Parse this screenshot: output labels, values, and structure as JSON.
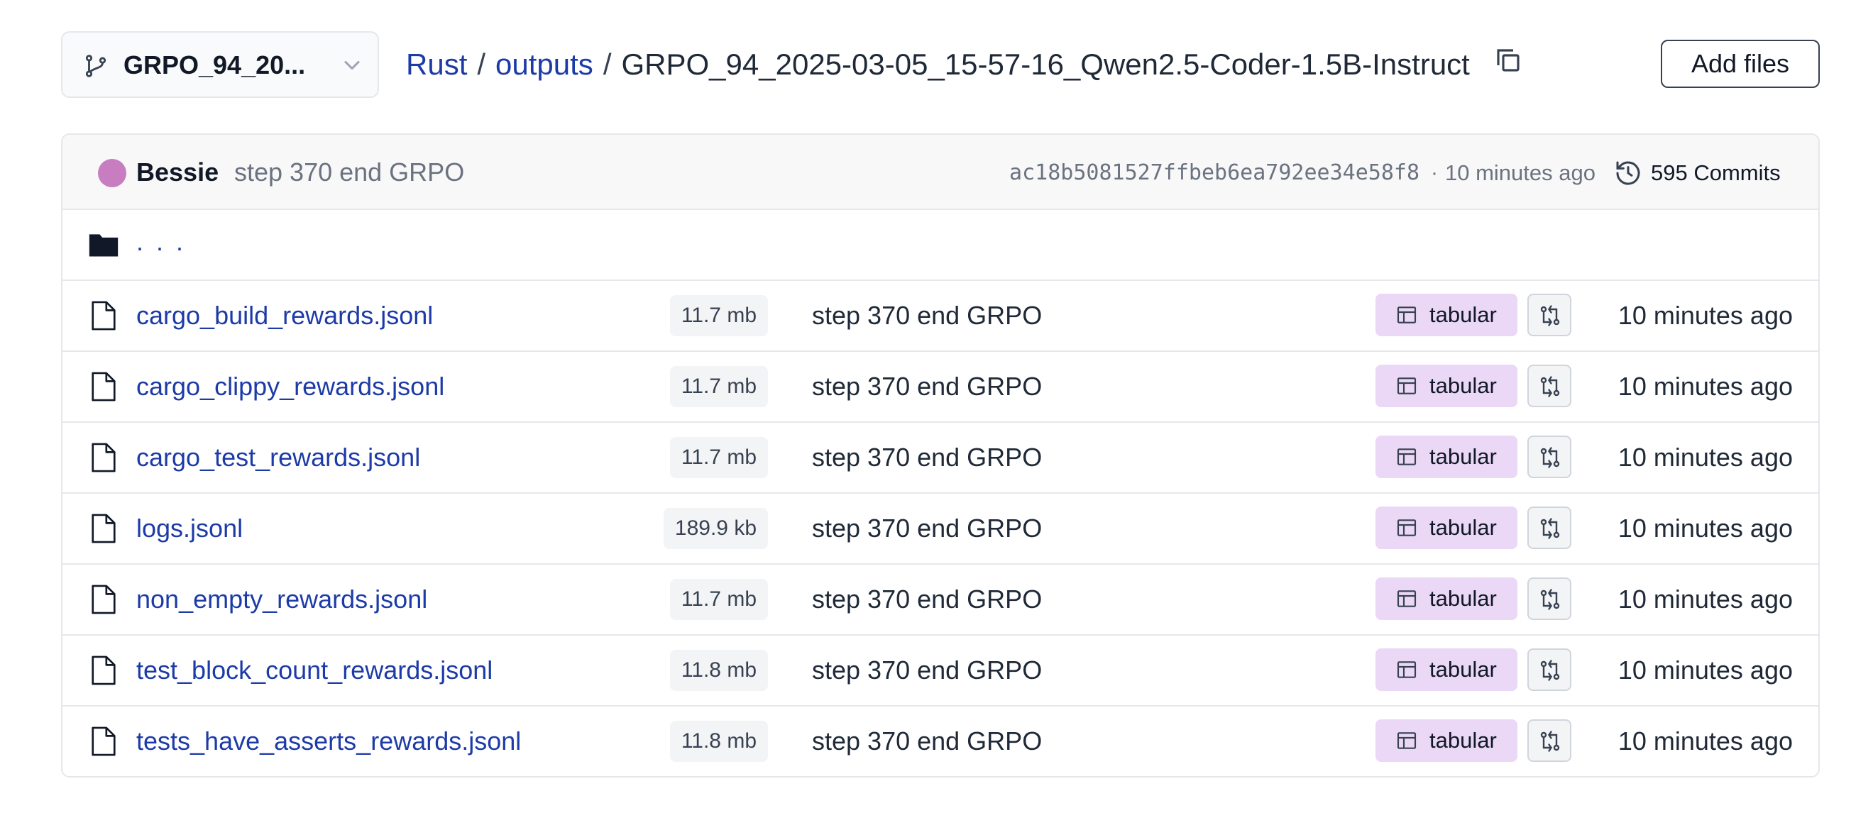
{
  "branch": {
    "name": "GRPO_94_20...",
    "icon": "git-branch-icon"
  },
  "breadcrumb": {
    "items": [
      "Rust",
      "outputs"
    ],
    "separator": "/",
    "current": "GRPO_94_2025-03-05_15-57-16_Qwen2.5-Coder-1.5B-Instruct"
  },
  "actions": {
    "add_files": "Add files"
  },
  "commit": {
    "author": "Bessie",
    "message": "step 370 end GRPO",
    "hash": "ac18b5081527ffbeb6ea792ee34e58f8",
    "separator": "·",
    "time": "10 minutes ago",
    "count": "595 Commits"
  },
  "parent_dir": {
    "label": ". . ."
  },
  "files": [
    {
      "name": "cargo_build_rewards.jsonl",
      "size": "11.7 mb",
      "message": "step 370 end GRPO",
      "viewer": "tabular",
      "time": "10 minutes ago"
    },
    {
      "name": "cargo_clippy_rewards.jsonl",
      "size": "11.7 mb",
      "message": "step 370 end GRPO",
      "viewer": "tabular",
      "time": "10 minutes ago"
    },
    {
      "name": "cargo_test_rewards.jsonl",
      "size": "11.7 mb",
      "message": "step 370 end GRPO",
      "viewer": "tabular",
      "time": "10 minutes ago"
    },
    {
      "name": "logs.jsonl",
      "size": "189.9 kb",
      "message": "step 370 end GRPO",
      "viewer": "tabular",
      "time": "10 minutes ago"
    },
    {
      "name": "non_empty_rewards.jsonl",
      "size": "11.7 mb",
      "message": "step 370 end GRPO",
      "viewer": "tabular",
      "time": "10 minutes ago"
    },
    {
      "name": "test_block_count_rewards.jsonl",
      "size": "11.8 mb",
      "message": "step 370 end GRPO",
      "viewer": "tabular",
      "time": "10 minutes ago"
    },
    {
      "name": "tests_have_asserts_rewards.jsonl",
      "size": "11.8 mb",
      "message": "step 370 end GRPO",
      "viewer": "tabular",
      "time": "10 minutes ago"
    }
  ],
  "colors": {
    "link": "#1d3ba7",
    "tabular_badge": "#ead8f6",
    "avatar": "#c77dbf"
  }
}
